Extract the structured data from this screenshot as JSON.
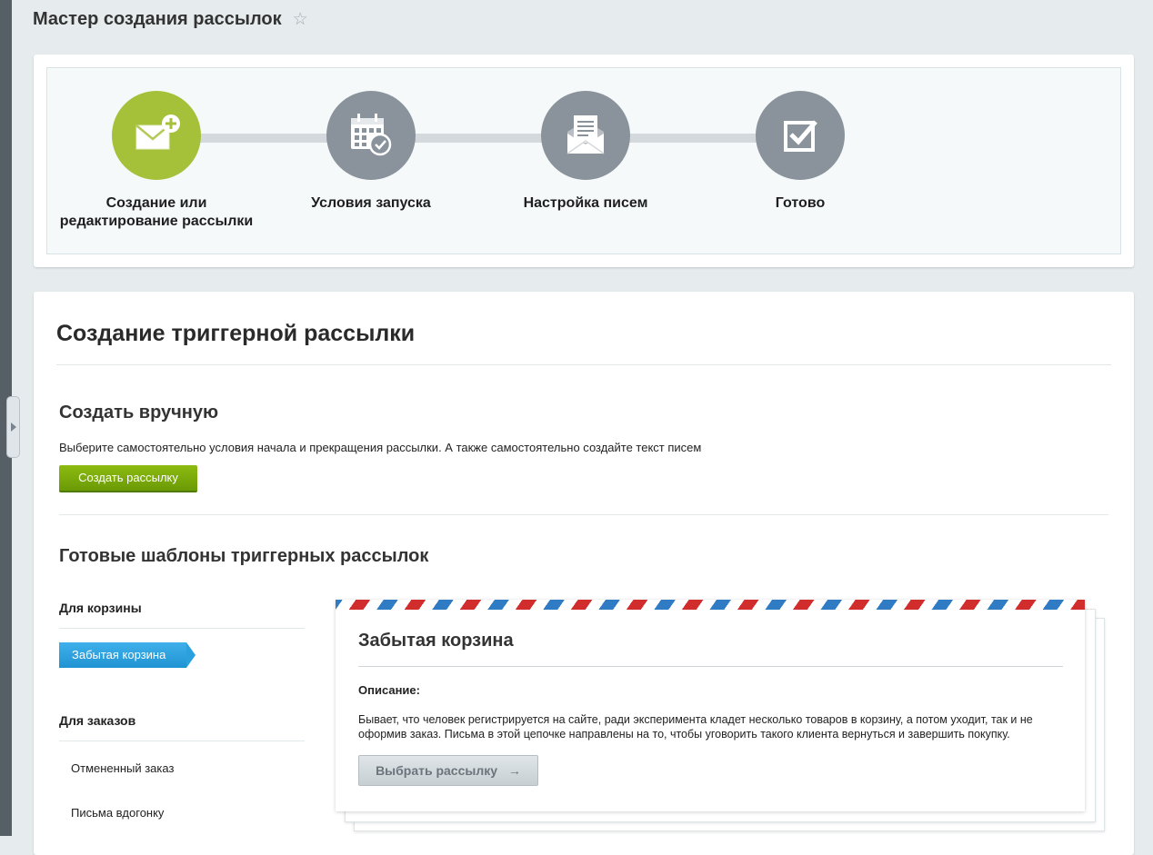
{
  "page": {
    "title": "Мастер создания рассылок",
    "favorite_icon": "star-icon"
  },
  "wizard": {
    "steps": [
      {
        "label": "Создание или редактирование рассылки",
        "icon": "mail-add-icon",
        "state": "active"
      },
      {
        "label": "Условия запуска",
        "icon": "calendar-check-icon",
        "state": "inactive"
      },
      {
        "label": "Настройка писем",
        "icon": "open-letter-icon",
        "state": "inactive"
      },
      {
        "label": "Готово",
        "icon": "checkbox-icon",
        "state": "inactive"
      }
    ]
  },
  "main": {
    "title": "Создание триггерной рассылки",
    "manual": {
      "title": "Создать вручную",
      "description": "Выберите самостоятельно условия начала и прекращения рассылки. А также самостоятельно создайте текст писем",
      "button": "Создать рассылку"
    },
    "templates": {
      "title": "Готовые шаблоны триггерных рассылок",
      "groups": [
        {
          "title": "Для корзины",
          "items": [
            "Забытая корзина"
          ],
          "selected": "Забытая корзина"
        },
        {
          "title": "Для заказов",
          "items": [
            "Отмененный заказ",
            "Письма вдогонку"
          ]
        }
      ],
      "detail": {
        "title": "Забытая корзина",
        "description_label": "Описание:",
        "description": "Бывает, что человек регистрируется на сайте, ради эксперимента кладет несколько товаров в корзину, а потом уходит, так и не оформив заказ. Письма в этой цепочке направлены на то, чтобы уговорить такого клиента вернуться и завершить покупку.",
        "button": "Выбрать рассылку",
        "button_icon": "arrow-right-icon"
      }
    }
  },
  "colors": {
    "active_step": "#a5c13a",
    "inactive_step": "#8a939b",
    "create_button": "#7aab0b",
    "selected_tag": "#2aa0de"
  }
}
